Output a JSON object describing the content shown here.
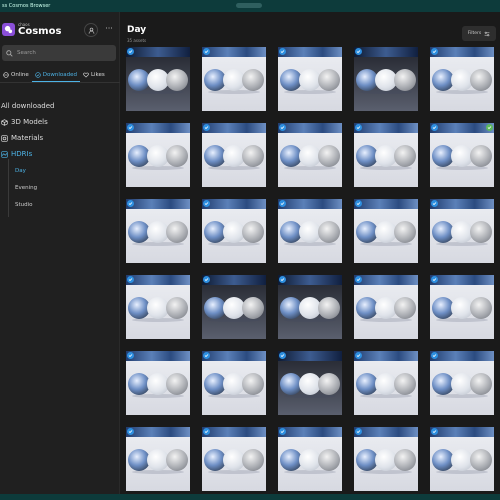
{
  "window": {
    "title": "ss Cosmos Browser"
  },
  "brand": {
    "small": "chaos",
    "big": "Cosmos"
  },
  "search": {
    "placeholder": "Search"
  },
  "tabs": [
    {
      "label": "Online"
    },
    {
      "label": "Downloaded"
    },
    {
      "label": "Likes"
    }
  ],
  "nav": {
    "all": "All downloaded",
    "models": "3D Models",
    "materials": "Materials",
    "hdris": "HDRIs",
    "subs": [
      "Day",
      "Evening",
      "Studio"
    ]
  },
  "main": {
    "title": "Day",
    "count": "35 assets",
    "filters_label": "Filters"
  },
  "colors": {
    "accent": "#4db3e6",
    "brand": "#8a4fd8",
    "check": "#2d8fe0"
  }
}
